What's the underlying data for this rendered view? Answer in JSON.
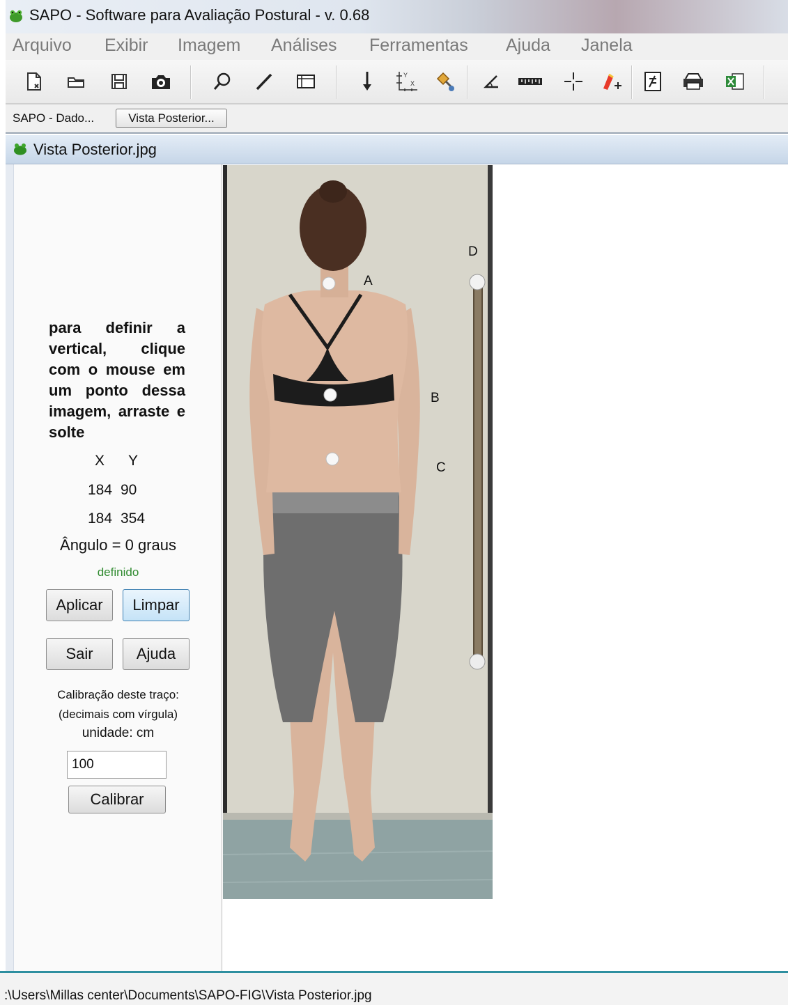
{
  "window": {
    "title": "SAPO - Software para Avaliação Postural - v. 0.68",
    "icon": "sapo-app-icon"
  },
  "menu": {
    "items": [
      "Arquivo",
      "Exibir",
      "Imagem",
      "Análises",
      "Ferramentas",
      "Ajuda",
      "Janela"
    ]
  },
  "toolbar": {
    "icons": [
      "new-document-icon",
      "open-folder-icon",
      "save-disk-icon",
      "camera-icon",
      "magnifier-icon",
      "pencil-line-icon",
      "crop-frame-icon",
      "vertical-arrow-icon",
      "axis-calibration-icon",
      "marker-points-icon",
      "angle-icon",
      "ruler-icon",
      "crosshair-icon",
      "auto-marker-icon",
      "report-icon",
      "printer-icon",
      "excel-export-icon"
    ]
  },
  "frames": {
    "items": [
      "SAPO - Dado...",
      "Vista Posterior..."
    ]
  },
  "internal_frame": {
    "title": "Vista Posterior.jpg"
  },
  "panel": {
    "instruction": "para definir a vertical, clique com o mouse em um ponto dessa imagem, arraste e solte",
    "coord_headers": [
      "X",
      "Y"
    ],
    "points": [
      {
        "x": "184",
        "y": "90"
      },
      {
        "x": "184",
        "y": "354"
      }
    ],
    "angle_text": "Ângulo = 0 graus",
    "status": "definido",
    "apply_label": "Aplicar",
    "clear_label": "Limpar",
    "exit_label": "Sair",
    "help_label": "Ajuda",
    "calib_line1": "Calibração deste traço:",
    "calib_line2": "(decimais com vírgula)",
    "calib_unit": "unidade: cm",
    "calib_value": "100",
    "calibrate_label": "Calibrar"
  },
  "image": {
    "marker_labels": [
      "A",
      "B",
      "C",
      "D"
    ]
  },
  "statusbar": {
    "path": ":\\Users\\Millas center\\Documents\\SAPO-FIG\\Vista Posterior.jpg"
  },
  "colors": {
    "accent": "#2e8fa0",
    "status_green": "#2f8a2f"
  }
}
